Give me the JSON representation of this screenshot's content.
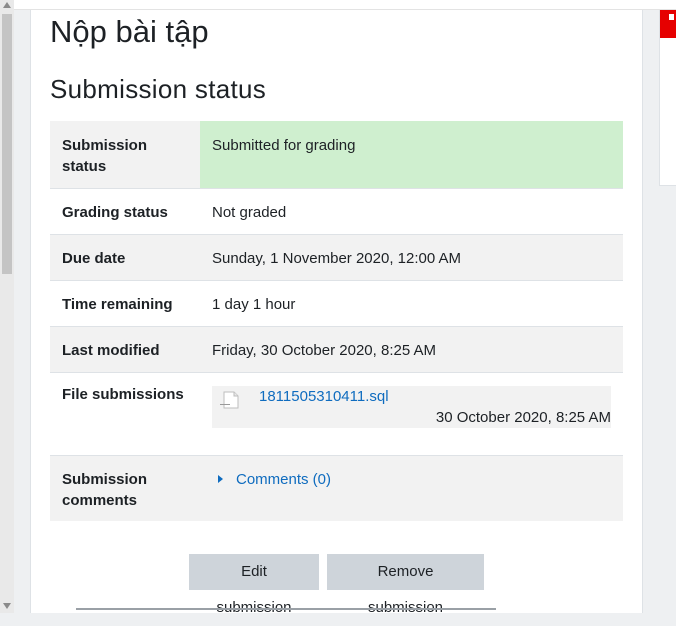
{
  "page": {
    "title": "Nộp bài tập",
    "section_title": "Submission status"
  },
  "status_table": {
    "rows": [
      {
        "label": "Submission status",
        "value": "Submitted for grading"
      },
      {
        "label": "Grading status",
        "value": "Not graded"
      },
      {
        "label": "Due date",
        "value": "Sunday, 1 November 2020, 12:00 AM"
      },
      {
        "label": "Time remaining",
        "value": "1 day 1 hour"
      },
      {
        "label": "Last modified",
        "value": "Friday, 30 October 2020, 8:25 AM"
      },
      {
        "label": "File submissions",
        "file_name": "1811505310411.sql",
        "file_time": "30 October 2020, 8:25 AM"
      },
      {
        "label": "Submission comments",
        "value": "Comments (0)"
      }
    ]
  },
  "buttons": {
    "edit": "Edit submission",
    "remove": "Remove submission"
  },
  "icons": {
    "file": "document-file-icon",
    "expand": "caret-right-icon"
  },
  "colors": {
    "submitted_bg": "#cfefcf",
    "link": "#0f6cbf",
    "button_bg": "#ced4da"
  }
}
